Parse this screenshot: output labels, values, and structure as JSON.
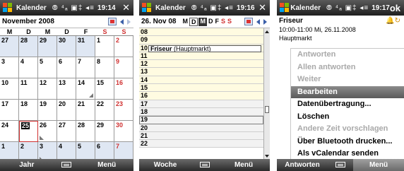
{
  "screens": [
    {
      "title": "Kalender",
      "status_icons": "⦾ ⁴ₐ ▣‡ ◂≡",
      "time": "19:14",
      "close": "✕",
      "header_title": "November 2008",
      "weekdays": [
        "M",
        "D",
        "M",
        "D",
        "F",
        "S",
        "S"
      ],
      "weeks": [
        [
          {
            "n": "27",
            "o": true
          },
          {
            "n": "28",
            "o": true
          },
          {
            "n": "29",
            "o": true
          },
          {
            "n": "30",
            "o": true
          },
          {
            "n": "31",
            "o": true
          },
          {
            "n": "1"
          },
          {
            "n": "2",
            "sun": true
          }
        ],
        [
          {
            "n": "3"
          },
          {
            "n": "4"
          },
          {
            "n": "5"
          },
          {
            "n": "6"
          },
          {
            "n": "7"
          },
          {
            "n": "8"
          },
          {
            "n": "9",
            "sun": true
          }
        ],
        [
          {
            "n": "10"
          },
          {
            "n": "11"
          },
          {
            "n": "12"
          },
          {
            "n": "13"
          },
          {
            "n": "14",
            "mark": "r"
          },
          {
            "n": "15"
          },
          {
            "n": "16",
            "sun": true
          }
        ],
        [
          {
            "n": "17"
          },
          {
            "n": "18"
          },
          {
            "n": "19"
          },
          {
            "n": "20"
          },
          {
            "n": "21"
          },
          {
            "n": "22"
          },
          {
            "n": "23",
            "sun": true
          }
        ],
        [
          {
            "n": "24"
          },
          {
            "n": "25",
            "today": true
          },
          {
            "n": "26",
            "mark": "l"
          },
          {
            "n": "27"
          },
          {
            "n": "28"
          },
          {
            "n": "29"
          },
          {
            "n": "30",
            "sun": true
          }
        ],
        [
          {
            "n": "1",
            "o": true
          },
          {
            "n": "2",
            "o": true
          },
          {
            "n": "3",
            "o": true,
            "mark": "l"
          },
          {
            "n": "4",
            "o": true
          },
          {
            "n": "5",
            "o": true
          },
          {
            "n": "6",
            "o": true
          },
          {
            "n": "7",
            "o": true,
            "sun": true
          }
        ]
      ],
      "soft_left": "Jahr",
      "soft_right": "Menü"
    },
    {
      "title": "Kalender",
      "status_icons": "⦾ ⁴ₐ ▣‡ ◂≡",
      "time": "19:16",
      "close": "✕",
      "header_title": "26. Nov 08",
      "week_letters": [
        {
          "l": "M"
        },
        {
          "l": "D",
          "box": true
        },
        {
          "l": "M",
          "sel": true
        },
        {
          "l": "D"
        },
        {
          "l": "F"
        },
        {
          "l": "S",
          "we": true
        },
        {
          "l": "S",
          "we": true
        }
      ],
      "hours": [
        {
          "h": "08"
        },
        {
          "h": "09"
        },
        {
          "h": "10",
          "appt": "Friseur",
          "loc": "(Hauptmarkt)"
        },
        {
          "h": "11"
        },
        {
          "h": "12"
        },
        {
          "h": "13"
        },
        {
          "h": "14"
        },
        {
          "h": "15"
        },
        {
          "h": "16"
        },
        {
          "h": "17",
          "free": true
        },
        {
          "h": "18",
          "free": true
        },
        {
          "h": "19",
          "free": true,
          "sel": true
        },
        {
          "h": "20",
          "free": true
        },
        {
          "h": "21",
          "free": true
        },
        {
          "h": "22",
          "free": true
        }
      ],
      "soft_left": "Woche",
      "soft_right": "Menü"
    },
    {
      "title": "Kalender",
      "status_icons": "⦾ ⁴ₐ ▣‡ ◂≡",
      "time": "19:17",
      "close": "ok",
      "subject": "Friseur",
      "reminder_icon": "🔔↻",
      "when": "10:00-11:00 Mi, 26.11.2008",
      "location": "Hauptmarkt",
      "menu": [
        {
          "label": "Antworten",
          "disabled": true
        },
        {
          "label": "Allen antworten",
          "disabled": true
        },
        {
          "label": "Weiter",
          "disabled": true
        },
        {
          "label": "Bearbeiten",
          "highlight": true
        },
        {
          "label": "Datenübertragung..."
        },
        {
          "label": "Löschen"
        },
        {
          "label": "Andere Zeit vorschlagen",
          "disabled": true
        },
        {
          "label": "Über Bluetooth drucken..."
        },
        {
          "label": "Als vCalendar senden"
        }
      ],
      "soft_left": "Antworten",
      "soft_right": "Menü"
    }
  ],
  "colors": {
    "weekend_red": "#d03030",
    "busy_yellow": "#fffbe1",
    "other_month_blue": "#dfe7f3",
    "highlight_gray": "#6a6a6a"
  }
}
